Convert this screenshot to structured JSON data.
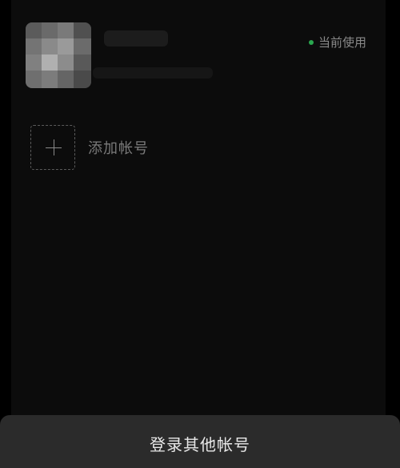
{
  "account": {
    "current_badge_label": "当前使用"
  },
  "add_account": {
    "label": "添加帐号"
  },
  "footer": {
    "login_other_label": "登录其他帐号"
  },
  "colors": {
    "background": "#000000",
    "panel": "#0c0c0c",
    "sheet": "#2b2b2b",
    "status_green": "#2aa84f"
  }
}
